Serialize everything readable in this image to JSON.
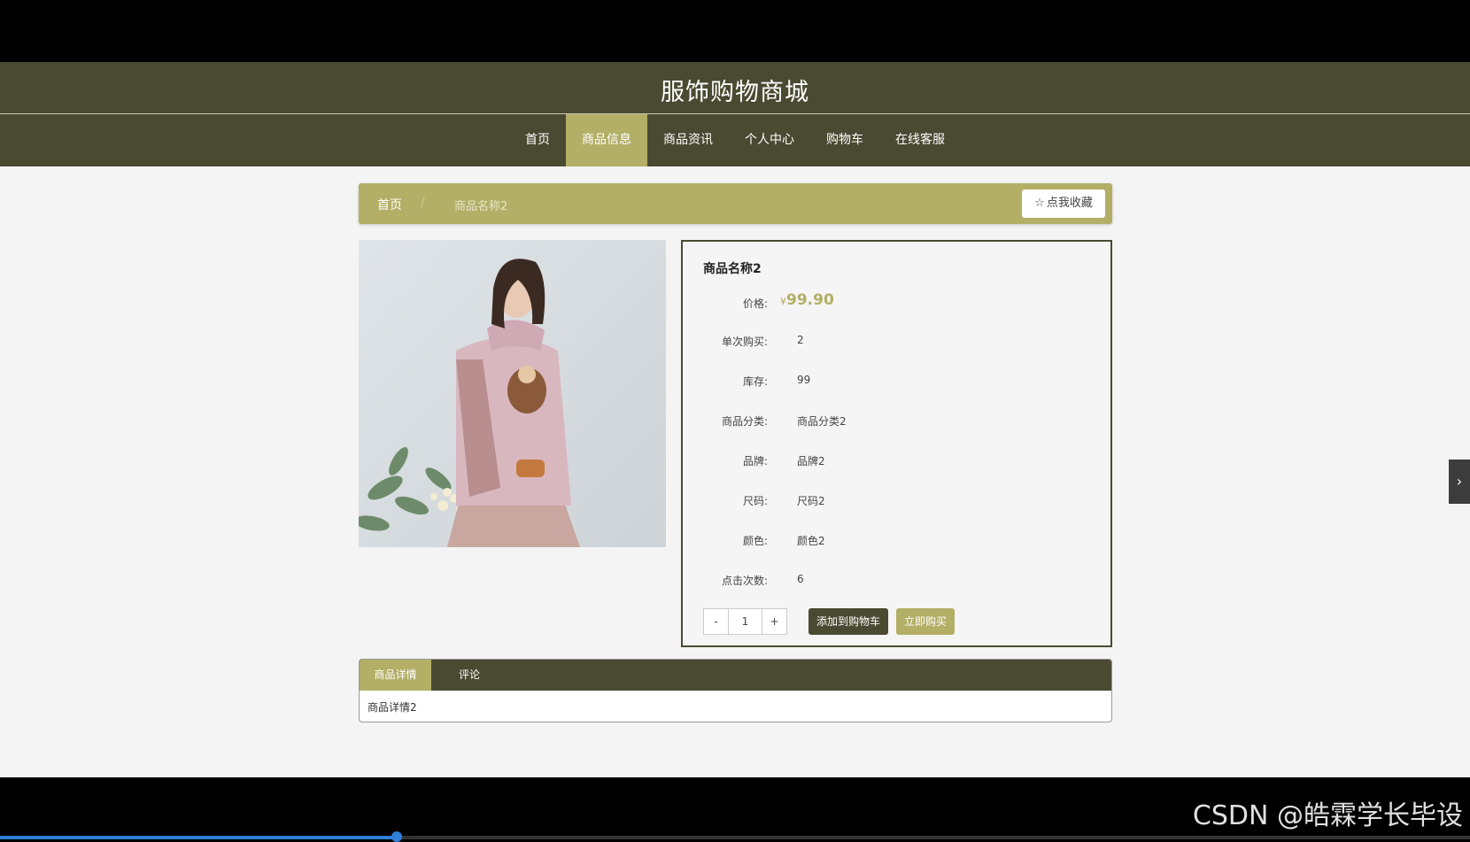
{
  "site": {
    "title": "服饰购物商城"
  },
  "nav": {
    "items": [
      {
        "label": "首页"
      },
      {
        "label": "商品信息"
      },
      {
        "label": "商品资讯"
      },
      {
        "label": "个人中心"
      },
      {
        "label": "购物车"
      },
      {
        "label": "在线客服"
      }
    ],
    "active_index": 1
  },
  "breadcrumb": {
    "home": "首页",
    "separator": "/",
    "current": "商品名称2"
  },
  "favorite": {
    "label": "点我收藏",
    "icon": "star-outline-icon"
  },
  "product": {
    "name": "商品名称2",
    "price_currency": "¥",
    "price": "99.90",
    "fields": [
      {
        "label": "价格:",
        "value": ""
      },
      {
        "label": "单次购买:",
        "value": "2"
      },
      {
        "label": "库存:",
        "value": "99"
      },
      {
        "label": "商品分类:",
        "value": "商品分类2"
      },
      {
        "label": "品牌:",
        "value": "品牌2"
      },
      {
        "label": "尺码:",
        "value": "尺码2"
      },
      {
        "label": "颜色:",
        "value": "颜色2"
      },
      {
        "label": "点击次数:",
        "value": "6"
      }
    ]
  },
  "quantity": {
    "minus": "-",
    "value": "1",
    "plus": "+"
  },
  "actions": {
    "add_to_cart": "添加到购物车",
    "buy_now": "立即购买"
  },
  "tabs": [
    {
      "label": "商品详情"
    },
    {
      "label": "评论"
    }
  ],
  "detail": {
    "content": "商品详情2"
  },
  "side_toggle": {
    "icon": "chevron-right-icon",
    "glyph": "›"
  },
  "watermark": "CSDN @皓霖学长毕设",
  "video": {
    "progress": 0.27
  },
  "colors": {
    "primary": "#4a4a32",
    "accent": "#b3af66",
    "background": "#f4f4f4"
  }
}
